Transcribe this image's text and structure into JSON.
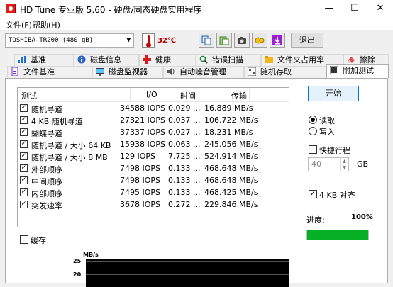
{
  "window": {
    "title": "HD Tune 专业版 5.60 - 硬盘/固态硬盘实用程序",
    "controls": [
      "—",
      "☐",
      "✕"
    ]
  },
  "menu": [
    "文件(F)",
    "帮助(H)"
  ],
  "toolbar": {
    "drive": "TOSHIBA-TR200 (480 gB)",
    "temperature": "32℃",
    "tool_icons": [
      "copy-icon",
      "paste-icon",
      "camera-icon",
      "options-icon",
      "save-download-icon"
    ],
    "exit_label": "退出"
  },
  "tabs": {
    "row1": [
      {
        "label": "基准",
        "icon": "benchmark-icon"
      },
      {
        "label": "磁盘信息",
        "icon": "info-icon"
      },
      {
        "label": "健康",
        "icon": "health-icon"
      },
      {
        "label": "错误扫描",
        "icon": "error-scan-icon"
      },
      {
        "label": "文件夹占用率",
        "icon": "folder-icon"
      },
      {
        "label": "擦除",
        "icon": "erase-icon"
      }
    ],
    "row2": [
      {
        "label": "文件基准",
        "icon": "file-benchmark-icon"
      },
      {
        "label": "磁盘监视器",
        "icon": "disk-monitor-icon"
      },
      {
        "label": "自动噪音管理",
        "icon": "noise-icon"
      },
      {
        "label": "随机存取",
        "icon": "random-access-icon"
      },
      {
        "label": "附加测试",
        "icon": "extra-tests-icon"
      }
    ],
    "active": "附加测试"
  },
  "table": {
    "headers": [
      "测试",
      "I/O",
      "时间",
      "传输"
    ],
    "rows": [
      {
        "test": "随机寻道",
        "io": "34588 IOPS",
        "time": "0.029 ...",
        "transfer": "16.889 MB/s"
      },
      {
        "test": "4 KB 随机寻道",
        "io": "27321 IOPS",
        "time": "0.037 ...",
        "transfer": "106.722 MB/s"
      },
      {
        "test": "蝴蝶寻道",
        "io": "37337 IOPS",
        "time": "0.027 ...",
        "transfer": "18.231 MB/s"
      },
      {
        "test": "随机寻道 / 大小 64 KB",
        "io": "15938 IOPS",
        "time": "0.063 ...",
        "transfer": "245.056 MB/s"
      },
      {
        "test": "随机寻道 / 大小 8 MB",
        "io": "129 IOPS",
        "time": "7.725 ...",
        "transfer": "524.914 MB/s"
      },
      {
        "test": "外部顺序",
        "io": "7498 IOPS",
        "time": "0.133 ...",
        "transfer": "468.648 MB/s"
      },
      {
        "test": "中间顺序",
        "io": "7498 IOPS",
        "time": "0.133 ...",
        "transfer": "468.648 MB/s"
      },
      {
        "test": "内部顺序",
        "io": "7495 IOPS",
        "time": "0.133 ...",
        "transfer": "468.425 MB/s"
      },
      {
        "test": "突发速率",
        "io": "3678 IOPS",
        "time": "0.272 ...",
        "transfer": "229.846 MB/s"
      }
    ]
  },
  "controls": {
    "start_label": "开始",
    "read_label": "读取",
    "write_label": "写入",
    "mode_selected": "读取",
    "quick_test_label": "快捷行程",
    "quick_value": "40",
    "quick_unit": "GB",
    "align_label": "4 KB 对齐",
    "progress_label": "进度:",
    "progress_text": "100%",
    "progress_fraction": 1.0,
    "cache_label": "缓存"
  },
  "graph": {
    "unit": "MB/s",
    "y_ticks": [
      "25",
      "20"
    ]
  },
  "colors": {
    "progress": "#06b025",
    "accent": "#0078d7",
    "temperature": "#c00000"
  }
}
